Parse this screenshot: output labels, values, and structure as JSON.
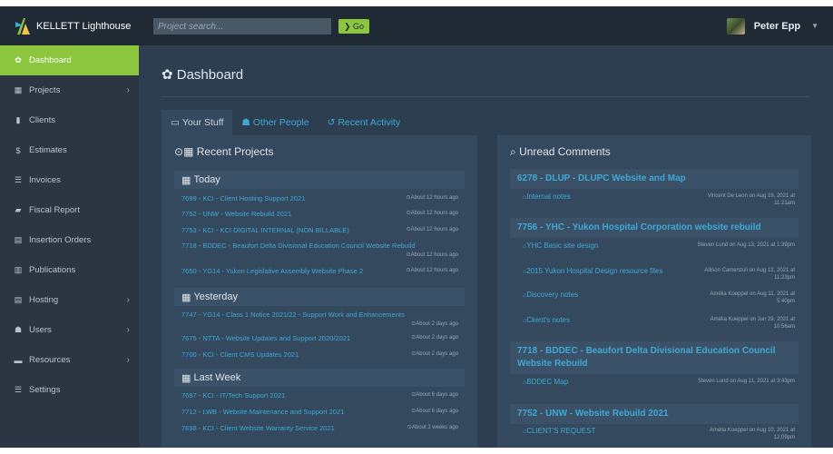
{
  "app": {
    "brand": "KELLETT Lighthouse"
  },
  "search": {
    "placeholder": "Project search...",
    "go_label": "Go"
  },
  "user": {
    "name": "Peter Epp"
  },
  "sidebar": {
    "items": [
      {
        "label": "Dashboard",
        "icon": "dashboard-icon",
        "glyph": "✿"
      },
      {
        "label": "Projects",
        "icon": "projects-icon",
        "glyph": "▦"
      },
      {
        "label": "Clients",
        "icon": "clients-icon",
        "glyph": "▮"
      },
      {
        "label": "Estimates",
        "icon": "dollar-icon",
        "glyph": "$"
      },
      {
        "label": "Invoices",
        "icon": "invoices-icon",
        "glyph": "☰"
      },
      {
        "label": "Fiscal Report",
        "icon": "fiscal-icon",
        "glyph": "▰"
      },
      {
        "label": "Insertion Orders",
        "icon": "orders-icon",
        "glyph": "▤"
      },
      {
        "label": "Publications",
        "icon": "publications-icon",
        "glyph": "▥"
      },
      {
        "label": "Hosting",
        "icon": "hosting-icon",
        "glyph": "▤"
      },
      {
        "label": "Users",
        "icon": "users-icon",
        "glyph": "☗"
      },
      {
        "label": "Resources",
        "icon": "resources-icon",
        "glyph": "▬"
      },
      {
        "label": "Settings",
        "icon": "settings-icon",
        "glyph": "☰"
      }
    ]
  },
  "main": {
    "title": "Dashboard",
    "tabs": [
      {
        "label": "Your Stuff",
        "glyph": "▭"
      },
      {
        "label": "Other People",
        "glyph": "☗"
      },
      {
        "label": "Recent Activity",
        "glyph": "↺"
      }
    ]
  },
  "recent_projects": {
    "heading": "Recent Projects",
    "sections": [
      {
        "label": "Today",
        "items": [
          {
            "title": "7699 - KCI - Client Hosting Support 2021",
            "time": "About 12 hours ago"
          },
          {
            "title": "7752 - UNW - Website Rebuild 2021",
            "time": "About 12 hours ago"
          },
          {
            "title": "7753 - KCI - KCI DIGITAL INTERNAL (NON BILLABLE)",
            "time": "About 12 hours ago"
          },
          {
            "title": "7718 - BDDEC - Beaufort Delta Divisional Education Council Website Rebuild",
            "time": "About 12 hours ago"
          },
          {
            "title": "7650 - YG14 - Yukon Legislative Assembly Website Phase 2",
            "time": "About 12 hours ago"
          }
        ]
      },
      {
        "label": "Yesterday",
        "items": [
          {
            "title": "7747 - YG14 - Class 1 Notice 2021/22 - Support Work and Enhancements",
            "time": "About 2 days ago"
          },
          {
            "title": "7675 - NTTA - Website Updates and Support 2020/2021",
            "time": "About 2 days ago"
          },
          {
            "title": "7700 - KCI - Client CMS Updates 2021",
            "time": "About 2 days ago"
          }
        ]
      },
      {
        "label": "Last Week",
        "items": [
          {
            "title": "7697 - KCI - IT/Tech Support 2021",
            "time": "About 6 days ago"
          },
          {
            "title": "7712 - LWB - Website Maintenance and Support 2021",
            "time": "About 6 days ago"
          },
          {
            "title": "7698 - KCI - Client Website Warranty Service 2021",
            "time": "About 2 weeks ago"
          }
        ]
      }
    ]
  },
  "unread_comments": {
    "heading": "Unread Comments",
    "groups": [
      {
        "title": "6278 - DLUP - DLUPC Website and Map",
        "items": [
          {
            "label": "Internal notes",
            "who": "Vincent De Leon on Aug 19, 2021 at 11:21am"
          }
        ]
      },
      {
        "title": "7756 - YHC - Yukon Hospital Corporation website rebuild",
        "items": [
          {
            "label": "YHC Basic site design",
            "who": "Steven Lund on Aug 13, 2021 at 1:39pm"
          },
          {
            "label": "2015 Yukon Hospital Design resource files",
            "who": "Allison Camenzuli on Aug 12, 2021 at 11:23pm"
          },
          {
            "label": "Discovery notes",
            "who": "Amélia Koeppel on Aug 11, 2021 at 5:40pm"
          },
          {
            "label": "Client's notes",
            "who": "Amélia Koeppel on Jun 29, 2021 at 10:56am"
          }
        ]
      },
      {
        "title": "7718 - BDDEC - Beaufort Delta Divisional Education Council Website Rebuild",
        "items": [
          {
            "label": "BDDEC Map",
            "who": "Steven Lund on Aug 11, 2021 at 3:43pm"
          }
        ]
      },
      {
        "title": "7752 - UNW - Website Rebuild 2021",
        "items": [
          {
            "label": "CLIENT'S REQUEST",
            "who": "Amélia Koeppel on Aug 10, 2021 at 12:09pm"
          }
        ]
      }
    ]
  },
  "colors": {
    "accent": "#8cc63f",
    "link": "#3fa9d5",
    "background": "#2c3e50",
    "panel": "#34495e"
  }
}
